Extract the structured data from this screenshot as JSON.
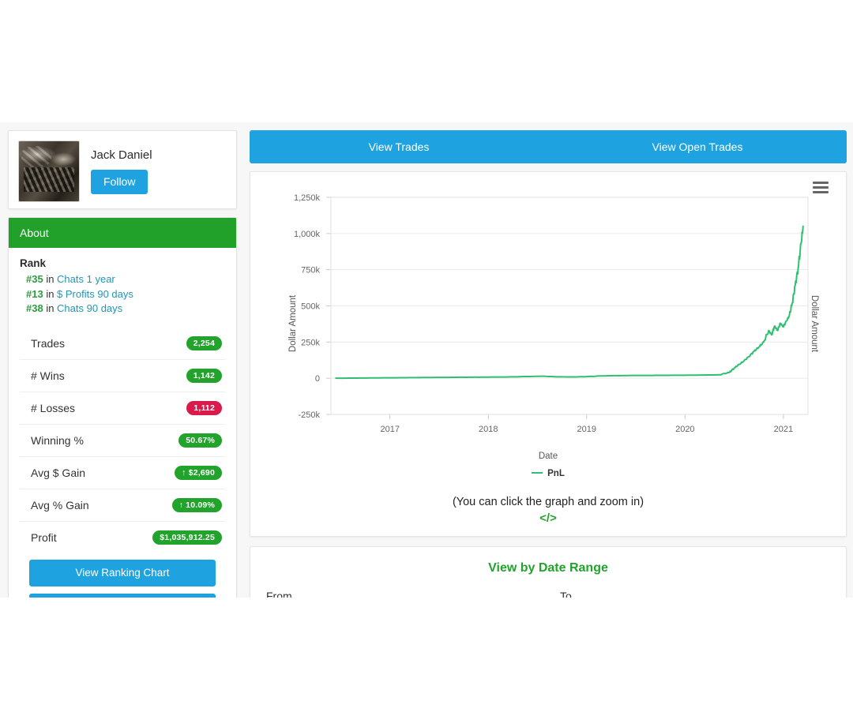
{
  "profile": {
    "name": "Jack Daniel",
    "follow_label": "Follow",
    "avatar_name": "user-avatar"
  },
  "about": {
    "header": "About",
    "rank_title": "Rank",
    "rank_lines": [
      {
        "num": "#35",
        "in": " in ",
        "link": "Chats 1 year"
      },
      {
        "num": "#13",
        "in": " in ",
        "link": "$ Profits 90 days"
      },
      {
        "num": "#38",
        "in": " in ",
        "link": "Chats 90 days"
      }
    ],
    "stats": [
      {
        "label": "Trades",
        "value": "2,254",
        "color": "green"
      },
      {
        "label": "# Wins",
        "value": "1,142",
        "color": "green"
      },
      {
        "label": "# Losses",
        "value": "1,112",
        "color": "red"
      },
      {
        "label": "Winning %",
        "value": "50.67%",
        "color": "green"
      },
      {
        "label": "Avg $ Gain",
        "value": "↑ $2,690",
        "color": "green"
      },
      {
        "label": "Avg % Gain",
        "value": "↑ 10.09%",
        "color": "green"
      },
      {
        "label": "Profit",
        "value": "$1,035,912.25",
        "color": "green"
      }
    ],
    "buttons": [
      {
        "label": "View Ranking Chart"
      },
      {
        "label": ""
      }
    ]
  },
  "tabs": [
    {
      "label": "View Trades"
    },
    {
      "label": "View Open Trades"
    }
  ],
  "chart_panel": {
    "note": "(You can click the graph and zoom in)",
    "code_icon": "</>",
    "menu_icon": "hamburger-icon"
  },
  "date_range": {
    "title": "View by Date Range",
    "from_label": "From",
    "to_label": "To",
    "from_value": "",
    "to_value": "",
    "from_placeholder": "",
    "to_placeholder": ""
  },
  "colors": {
    "brand_blue": "#1fa2e0",
    "brand_green": "#21a02a",
    "badge_green": "#21a32c",
    "badge_red": "#d81b4a",
    "line_green": "#2fbf71",
    "link_blue": "#2196b4"
  },
  "chart_data": {
    "type": "line",
    "title": "",
    "xlabel": "Date",
    "ylabel": "Dollar Amount",
    "ylabel_right": "Dollar Amount",
    "legend": [
      "PnL"
    ],
    "legend_position": "bottom-center",
    "grid": true,
    "xlim": [
      2016.4,
      2021.25
    ],
    "ylim": [
      -250000,
      1250000
    ],
    "xticks": [
      "2017",
      "2018",
      "2019",
      "2020",
      "2021"
    ],
    "yticks": [
      "-250k",
      "0",
      "250k",
      "500k",
      "750k",
      "1,000k",
      "1,250k"
    ],
    "ytick_values": [
      -250000,
      0,
      250000,
      500000,
      750000,
      1000000,
      1250000
    ],
    "series": [
      {
        "name": "PnL",
        "color": "#2fbf71",
        "x": [
          2016.45,
          2016.6,
          2016.8,
          2017.0,
          2017.2,
          2017.4,
          2017.6,
          2017.8,
          2018.0,
          2018.2,
          2018.4,
          2018.55,
          2018.7,
          2018.85,
          2019.0,
          2019.15,
          2019.3,
          2019.45,
          2019.6,
          2019.8,
          2020.0,
          2020.2,
          2020.35,
          2020.45,
          2020.5,
          2020.55,
          2020.6,
          2020.65,
          2020.7,
          2020.75,
          2020.8,
          2020.85,
          2020.88,
          2020.91,
          2020.94,
          2020.97,
          2021.0,
          2021.03,
          2021.06,
          2021.09,
          2021.12,
          2021.15,
          2021.18,
          2021.2
        ],
        "y": [
          0,
          1000,
          2000,
          3000,
          4000,
          5000,
          6000,
          7000,
          8000,
          9000,
          12000,
          14000,
          10000,
          9000,
          11000,
          16000,
          18000,
          19000,
          19500,
          20000,
          21000,
          22000,
          24000,
          40000,
          70000,
          95000,
          120000,
          150000,
          185000,
          215000,
          250000,
          330000,
          300000,
          360000,
          330000,
          380000,
          355000,
          395000,
          430000,
          520000,
          640000,
          760000,
          930000,
          1050000
        ]
      }
    ]
  }
}
